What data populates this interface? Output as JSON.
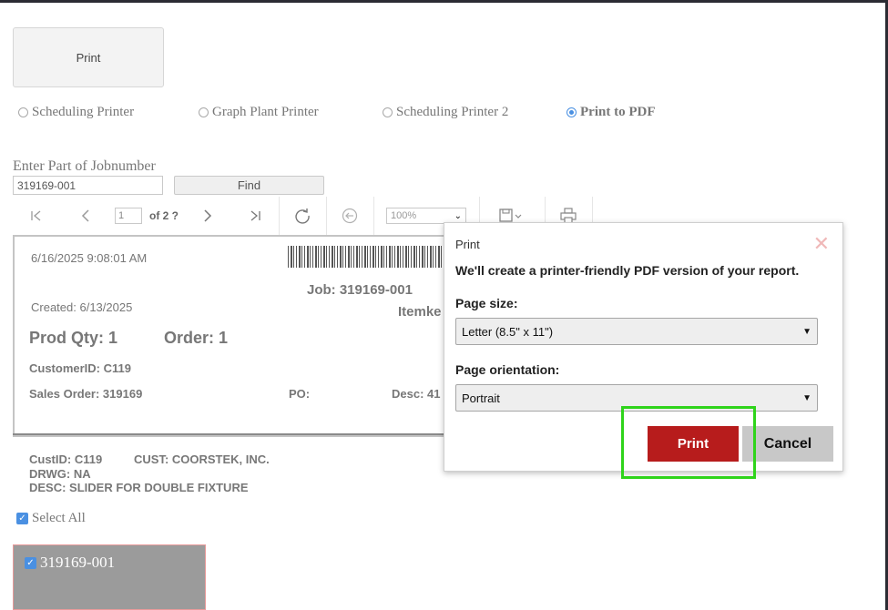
{
  "header": {
    "print_button": "Print"
  },
  "printers": [
    {
      "label": "Scheduling Printer",
      "selected": false
    },
    {
      "label": "Graph Plant Printer",
      "selected": false
    },
    {
      "label": "Scheduling Printer 2",
      "selected": false
    },
    {
      "label": "Print to PDF",
      "selected": true
    }
  ],
  "search": {
    "label": "Enter Part of Jobnumber",
    "value": "319169-001",
    "find_button": "Find"
  },
  "viewer": {
    "page_value": "1",
    "of_pages": "of 2 ?",
    "zoom": "100%"
  },
  "report": {
    "datetime": "6/16/2025 9:08:01 AM",
    "job": "Job: 319169-001",
    "itemkey": "Itemke",
    "created": "Created: 6/13/2025",
    "prod_qty": "Prod Qty: 1",
    "order": "Order: 1",
    "customer_id": "CustomerID: C119",
    "sales_order": "Sales Order: 319169",
    "po": "PO:",
    "desc": "Desc: 41",
    "cust_id": "CustID: C119",
    "cust": "CUST: COORSTEK, INC.",
    "drwg": "DRWG: NA",
    "desc_full": "DESC: SLIDER FOR DOUBLE FIXTURE"
  },
  "selection": {
    "select_all": "Select All",
    "job_item": "319169-001"
  },
  "dialog": {
    "title": "Print",
    "description": "We'll create a printer-friendly PDF version of your report.",
    "page_size_label": "Page size:",
    "page_size_value": "Letter (8.5\" x 11\")",
    "orientation_label": "Page orientation:",
    "orientation_value": "Portrait",
    "print_button": "Print",
    "cancel_button": "Cancel",
    "accent_color": "#b71c1c"
  },
  "icons": [
    "first-page-icon",
    "prev-page-icon",
    "next-page-icon",
    "last-page-icon",
    "refresh-icon",
    "back-icon",
    "save-icon",
    "print-icon",
    "close-icon",
    "checkbox-icon",
    "chevron-down-icon"
  ]
}
